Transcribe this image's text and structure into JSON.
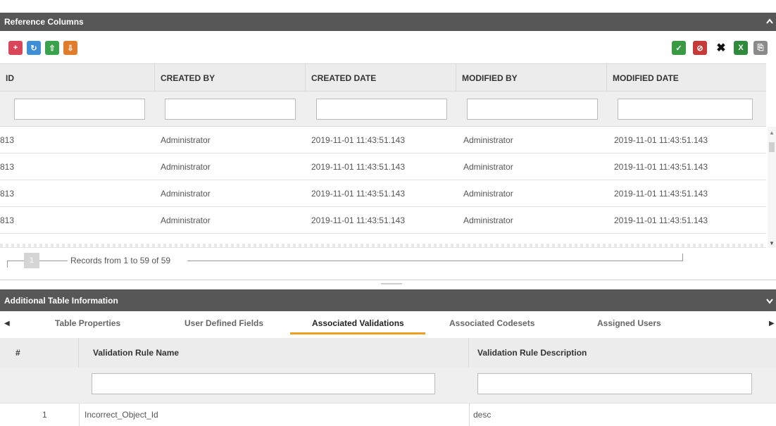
{
  "reference_panel": {
    "title": "Reference Columns",
    "collapse_glyph": "^",
    "toolbar_left_icons": [
      "add-record-icon",
      "refresh-icon",
      "export-icon",
      "import-icon"
    ],
    "toolbar_right_icons": [
      "save-icon",
      "save-cancel-icon",
      "delete-icon",
      "excel-icon",
      "copy-icon"
    ],
    "columns": [
      "ID",
      "CREATED BY",
      "CREATED DATE",
      "MODIFIED BY",
      "MODIFIED DATE"
    ],
    "rows": [
      [
        "813",
        "Administrator",
        "2019-11-01 11:43:51.143",
        "Administrator",
        "2019-11-01 11:43:51.143"
      ],
      [
        "813",
        "Administrator",
        "2019-11-01 11:43:51.143",
        "Administrator",
        "2019-11-01 11:43:51.143"
      ],
      [
        "813",
        "Administrator",
        "2019-11-01 11:43:51.143",
        "Administrator",
        "2019-11-01 11:43:51.143"
      ],
      [
        "813",
        "Administrator",
        "2019-11-01 11:43:51.143",
        "Administrator",
        "2019-11-01 11:43:51.143"
      ]
    ],
    "pager": {
      "page": "1",
      "records_text": "Records from 1 to 59 of 59"
    }
  },
  "additional_panel": {
    "title": "Additional Table Information",
    "collapse_glyph": "v",
    "tabs": [
      "Table Properties",
      "User Defined Fields",
      "Associated Validations",
      "Associated Codesets",
      "Assigned Users"
    ],
    "active_tab": "Associated Validations",
    "validation_columns": [
      "#",
      "Validation Rule Name",
      "Validation Rule Description"
    ],
    "validation_rows": [
      [
        "1",
        "Incorrect_Object_Id",
        "desc"
      ]
    ]
  },
  "colors": {
    "header_bg": "#575757",
    "active_tab_accent": "#f0a01e"
  }
}
